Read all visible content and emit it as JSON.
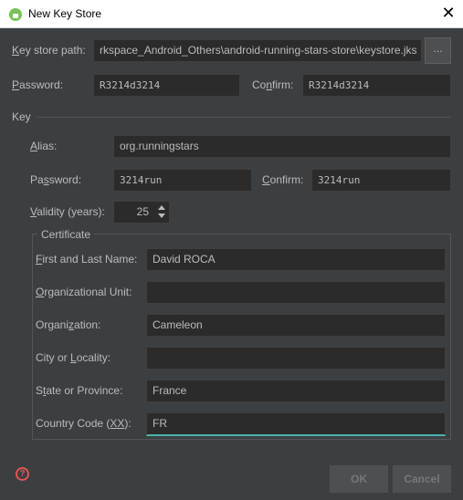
{
  "window": {
    "title": "New Key Store",
    "close_glyph": "✕"
  },
  "keystore": {
    "path_label_u": "K",
    "path_label_rest": "ey store path:",
    "path_value": "rkspace_Android_Others\\android-running-stars-store\\keystore.jks",
    "browse_label": "...",
    "password_label_u": "P",
    "password_label_rest": "assword:",
    "password_value": "R3214d3214",
    "confirm_label_a": "Co",
    "confirm_label_u": "n",
    "confirm_label_rest": "firm:",
    "confirm_value": "R3214d3214"
  },
  "key": {
    "section_label": "Key",
    "alias_label_u": "A",
    "alias_label_rest": "lias:",
    "alias_value": "org.runningstars",
    "password_label_a": "Pa",
    "password_label_u": "s",
    "password_label_rest": "sword:",
    "password_value": "3214run",
    "confirm_label_u": "C",
    "confirm_label_rest": "onfirm:",
    "confirm_value": "3214run",
    "validity_label_u": "V",
    "validity_label_rest": "alidity (years):",
    "validity_value": "25"
  },
  "certificate": {
    "group_label": "Certificate",
    "first_last_label_u": "F",
    "first_last_label_rest": "irst and Last Name:",
    "first_last_value": "David ROCA",
    "org_unit_label_u": "O",
    "org_unit_label_rest": "rganizational Unit:",
    "org_unit_value": "",
    "org_label_a": "Organi",
    "org_label_u": "z",
    "org_label_rest": "ation:",
    "org_value": "Cameleon",
    "city_label_a": "City or ",
    "city_label_u": "L",
    "city_label_rest": "ocality:",
    "city_value": "",
    "state_label_a": "S",
    "state_label_u": "t",
    "state_label_rest": "ate or Province:",
    "state_value": "France",
    "country_label_a": "Country Code (",
    "country_label_u": "XX",
    "country_label_rest": "):",
    "country_value": "FR"
  },
  "footer": {
    "ok_label": "OK",
    "cancel_label": "Cancel",
    "help_glyph": "?"
  },
  "colors": {
    "background": "#3c3f41",
    "field": "#2b2b2b",
    "focus_accent": "#4ab4a8",
    "help": "#e05555"
  },
  "icons": [
    "android-studio-icon",
    "close-icon",
    "spinner-arrows-icon",
    "help-icon"
  ]
}
